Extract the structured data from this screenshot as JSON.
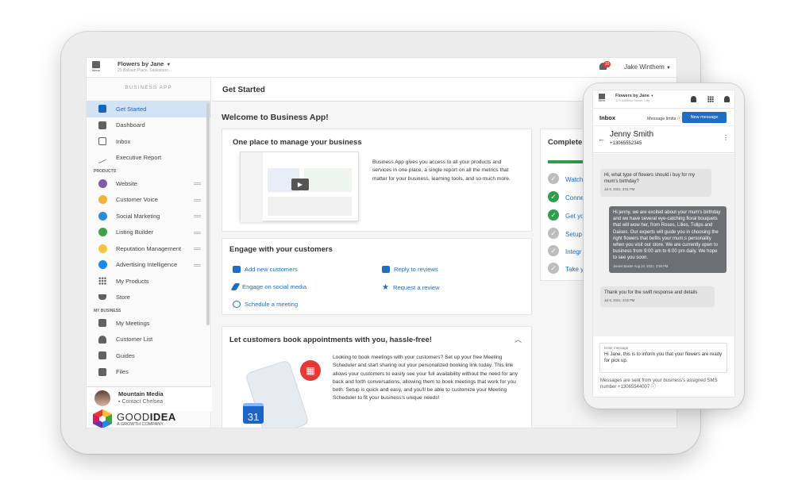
{
  "app": {
    "menu_label": "Menu",
    "business_name": "Flowers by Jane",
    "business_address": "25 Balsam Place, Saskatoon",
    "notification_count": "10",
    "user_name": "Jake Winthem"
  },
  "sidebar": {
    "title": "BUSINESS APP",
    "top_items": [
      {
        "label": "Get Started",
        "icon": "book-open-icon"
      },
      {
        "label": "Dashboard",
        "icon": "dashboard-icon"
      },
      {
        "label": "Inbox",
        "icon": "inbox-icon"
      },
      {
        "label": "Executive Report",
        "icon": "trend-icon"
      }
    ],
    "products_heading": "PRODUCTS",
    "products": [
      {
        "label": "Website",
        "color": "#7b5ea7"
      },
      {
        "label": "Customer Voice",
        "color": "#f4b03e"
      },
      {
        "label": "Social Marketing",
        "color": "#2f8ad8"
      },
      {
        "label": "Listing Builder",
        "color": "#43a047"
      },
      {
        "label": "Reputation Management",
        "color": "#f5c242"
      },
      {
        "label": "Advertising Intelligence",
        "color": "#1e88e5"
      },
      {
        "label": "My Products",
        "icon": "grid-icon"
      },
      {
        "label": "Store",
        "icon": "basket-icon"
      }
    ],
    "my_business_heading": "MY BUSINESS",
    "my_business": [
      {
        "label": "My Meetings"
      },
      {
        "label": "Customer List"
      },
      {
        "label": "Guides"
      },
      {
        "label": "Files"
      }
    ],
    "account_name": "Mountain Media",
    "account_contact": "Contact Chelsea"
  },
  "logo": {
    "word1": "GOOD",
    "word2": "IDEA",
    "tagline": "A GROWTH COMPANY"
  },
  "main": {
    "header": "Get Started",
    "welcome": "Welcome to Business App!",
    "manage": {
      "title": "One place to manage your business",
      "body": "Business App gives you access to all your products and services in one place, a single report on all the metrics that matter for your business, learning tools, and so much more."
    },
    "engage": {
      "title": "Engage with your customers",
      "links": [
        {
          "label": "Add new customers"
        },
        {
          "label": "Engage on social media"
        },
        {
          "label": "Schedule a meeting"
        },
        {
          "label": "Reply to reviews"
        },
        {
          "label": "Request a review"
        }
      ]
    },
    "appointments": {
      "title": "Let customers book appointments with you, hassle-free!",
      "body": "Looking to book meetings with your customers? Set up your free Meeting Scheduler and start sharing out your personalized booking link today. This link allows your customers to easily see your full availability without the need for any back and forth conversations, allowing them to book meetings that work for you both. Setup is quick and easy, and you'll be able to customize your Meeting Scheduler to fit your business's unique needs!",
      "calendar_day": "31"
    },
    "checklist": {
      "title": "Complete",
      "items": [
        {
          "label": "Watch",
          "done": false
        },
        {
          "label": "Conne",
          "done": true
        },
        {
          "label": "Get yo",
          "done": true
        },
        {
          "label": "Setup",
          "done": false
        },
        {
          "label": "Integr",
          "done": false
        },
        {
          "label": "Take y",
          "done": false
        }
      ]
    }
  },
  "phone": {
    "menu_label": "Menu",
    "business_name": "Flowers by Jane",
    "business_address": "123 Address Street, City",
    "inbox_title": "Inbox",
    "message_limits": "Message limits",
    "new_message": "New message",
    "contact_name": "Jenny Smith",
    "contact_phone": "+13065552345",
    "messages": [
      {
        "text": "Hi, what type of flowers should i buy for my mum's birthday?",
        "meta": "Jul 6, 2021, 3:51 PM"
      },
      {
        "text": "Hi jenny, we are excited about your mum's birthday and we have several eye-catching floral bouquets that will wow her, from Roses, Lilies, Tulips and Daises. Our experts will guide you in choosing the right flowers that befits your mum;s personality when you visit our store. We are currently open to business from 9:00 am to 6:00 pm daily. We hope to see you soon.",
        "meta": "James Baxter Aug 24, 2021, 3:56 PM"
      },
      {
        "text": "Thank you for the swift response and details",
        "meta": "Jul 6, 2021, 4:02 PM"
      }
    ],
    "composer_label": "Enter message",
    "composer_text": "Hi Jane, this is to inform you that your flowers are ready for pick up.",
    "footer": "Messages are sent from your business's assigned SMS number +13065544007"
  }
}
